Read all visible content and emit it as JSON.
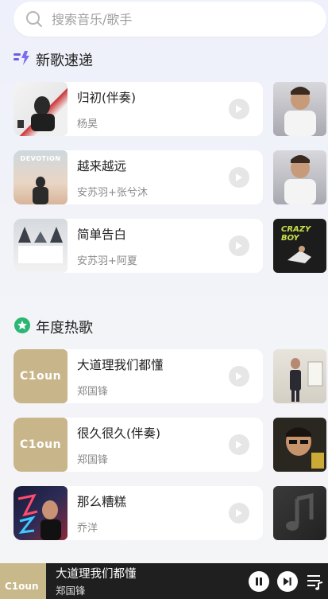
{
  "search": {
    "placeholder": "搜索音乐/歌手"
  },
  "sections": [
    {
      "title": "新歌速递",
      "icon": "new-songs-icon",
      "songs": [
        {
          "title": "归初(伴奏)",
          "artist": "杨昊"
        },
        {
          "title": "越来越远",
          "artist": "安苏羽+张兮沐"
        },
        {
          "title": "简单告白",
          "artist": "安苏羽+阿夏"
        }
      ]
    },
    {
      "title": "年度热歌",
      "icon": "medal-icon",
      "songs": [
        {
          "title": "大道理我们都懂",
          "artist": "郑国锋"
        },
        {
          "title": "很久很久(伴奏)",
          "artist": "郑国锋"
        },
        {
          "title": "那么糟糕",
          "artist": "乔洋"
        }
      ]
    }
  ],
  "cover_texts": {
    "devotion": "DEVOTION",
    "cloud": "C1oun",
    "crazyboy": "CRAZY BOY"
  },
  "player": {
    "title": "大道理我们都懂",
    "artist": "郑国锋"
  },
  "colors": {
    "accent_purple": "#6c5ce7",
    "medal_green": "#2bb673",
    "player_bg": "#1f1f1f"
  }
}
